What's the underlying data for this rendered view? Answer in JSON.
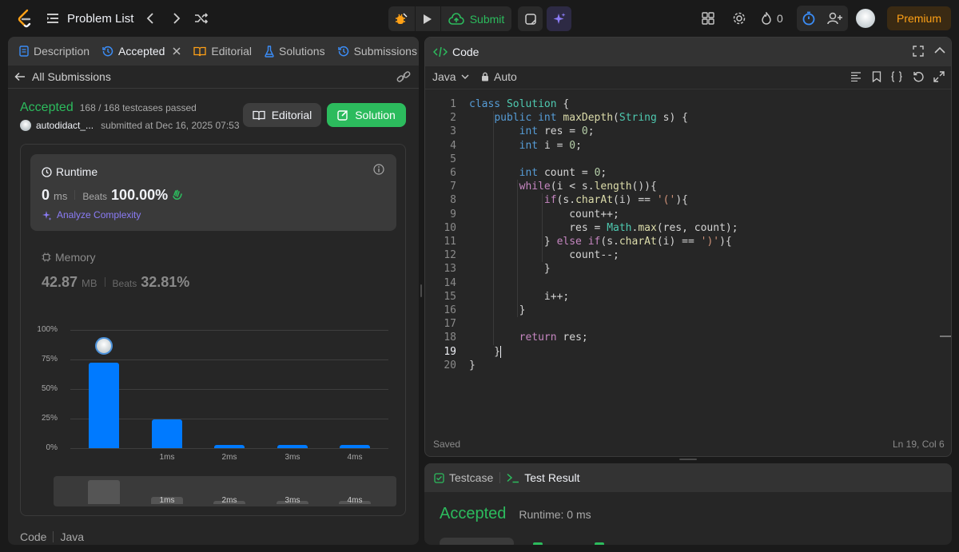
{
  "topbar": {
    "problem_list": "Problem List",
    "submit": "Submit",
    "streak": "0",
    "premium": "Premium"
  },
  "left": {
    "tabs": [
      "Description",
      "Accepted",
      "Editorial",
      "Solutions",
      "Submissions"
    ],
    "back_label": "All Submissions",
    "status": "Accepted",
    "testcases": "168 / 168 testcases passed",
    "user": "autodidact_...",
    "submitted_at": "submitted at Dec 16, 2025 07:53",
    "editorial_btn": "Editorial",
    "solution_btn": "Solution",
    "runtime": {
      "title": "Runtime",
      "value": "0",
      "unit": "ms",
      "beats_label": "Beats",
      "beats": "100.00%",
      "analyze": "Analyze Complexity"
    },
    "memory": {
      "title": "Memory",
      "value": "42.87",
      "unit": "MB",
      "beats_label": "Beats",
      "beats": "32.81%"
    },
    "footer": {
      "code": "Code",
      "lang": "Java"
    }
  },
  "chart_data": {
    "type": "bar",
    "categories": [
      "",
      "1ms",
      "2ms",
      "3ms",
      "4ms"
    ],
    "values": [
      72,
      24,
      3,
      3,
      3
    ],
    "y_ticks": [
      "100%",
      "75%",
      "50%",
      "25%",
      "0%"
    ],
    "ylim": [
      0,
      100
    ],
    "mini_labels": [
      "",
      "1ms",
      "2ms",
      "3ms",
      "4ms"
    ],
    "mini_values": [
      100,
      30,
      15,
      15,
      15
    ],
    "colors": {
      "bar": "#007aff",
      "mini": "#555555"
    }
  },
  "code_panel": {
    "title": "Code",
    "language": "Java",
    "mode": "Auto",
    "saved": "Saved",
    "cursor": "Ln 19, Col 6",
    "lines": [
      [
        [
          "kw2",
          "class "
        ],
        [
          "cls",
          "Solution "
        ],
        [
          "pl",
          "{"
        ]
      ],
      [
        [
          "pl",
          "    "
        ],
        [
          "kw2",
          "public "
        ],
        [
          "kw2",
          "int "
        ],
        [
          "fn",
          "maxDepth"
        ],
        [
          "pl",
          "("
        ],
        [
          "ty",
          "String "
        ],
        [
          "pl",
          "s) {"
        ]
      ],
      [
        [
          "pl",
          "        "
        ],
        [
          "kw2",
          "int "
        ],
        [
          "pl",
          "res = "
        ],
        [
          "num",
          "0"
        ],
        [
          "pl",
          ";"
        ]
      ],
      [
        [
          "pl",
          "        "
        ],
        [
          "kw2",
          "int "
        ],
        [
          "pl",
          "i = "
        ],
        [
          "num",
          "0"
        ],
        [
          "pl",
          ";"
        ]
      ],
      [],
      [
        [
          "pl",
          "        "
        ],
        [
          "kw2",
          "int "
        ],
        [
          "pl",
          "count = "
        ],
        [
          "num",
          "0"
        ],
        [
          "pl",
          ";"
        ]
      ],
      [
        [
          "pl",
          "        "
        ],
        [
          "kw",
          "while"
        ],
        [
          "pl",
          "(i < s."
        ],
        [
          "fn",
          "length"
        ],
        [
          "pl",
          "()){"
        ]
      ],
      [
        [
          "pl",
          "            "
        ],
        [
          "kw",
          "if"
        ],
        [
          "pl",
          "(s."
        ],
        [
          "fn",
          "charAt"
        ],
        [
          "pl",
          "(i) == "
        ],
        [
          "str",
          "'('"
        ],
        [
          "pl",
          "){"
        ]
      ],
      [
        [
          "pl",
          "                count++;"
        ]
      ],
      [
        [
          "pl",
          "                res = "
        ],
        [
          "ty",
          "Math"
        ],
        [
          "pl",
          "."
        ],
        [
          "fn",
          "max"
        ],
        [
          "pl",
          "(res, count);"
        ]
      ],
      [
        [
          "pl",
          "            } "
        ],
        [
          "kw",
          "else if"
        ],
        [
          "pl",
          "(s."
        ],
        [
          "fn",
          "charAt"
        ],
        [
          "pl",
          "(i) == "
        ],
        [
          "str",
          "')'"
        ],
        [
          "pl",
          "){"
        ]
      ],
      [
        [
          "pl",
          "                count--;"
        ]
      ],
      [
        [
          "pl",
          "            }"
        ]
      ],
      [],
      [
        [
          "pl",
          "            i++;"
        ]
      ],
      [
        [
          "pl",
          "        }"
        ]
      ],
      [],
      [
        [
          "pl",
          "        "
        ],
        [
          "kw",
          "return "
        ],
        [
          "pl",
          "res;"
        ]
      ],
      [
        [
          "pl",
          "    }"
        ]
      ],
      [
        [
          "pl",
          "}"
        ]
      ]
    ]
  },
  "result_panel": {
    "tabs": [
      "Testcase",
      "Test Result"
    ],
    "status": "Accepted",
    "runtime": "Runtime: 0 ms"
  }
}
